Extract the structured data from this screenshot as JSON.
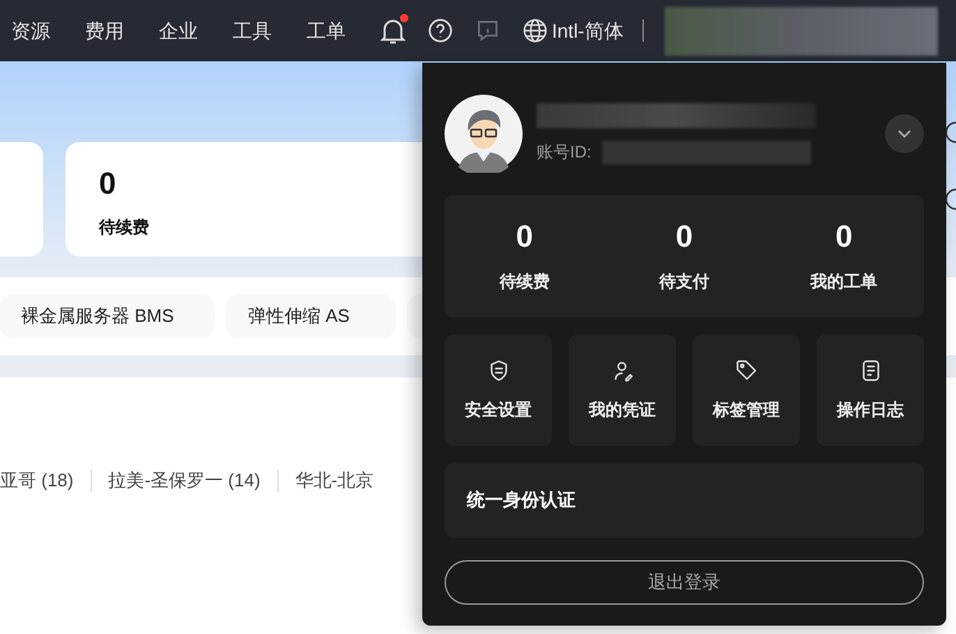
{
  "nav": {
    "items": [
      "资源",
      "费用",
      "企业",
      "工具",
      "工单"
    ],
    "notifications_unread": true,
    "language": "Intl-简体"
  },
  "summary_card": {
    "value": "0",
    "label": "待续费"
  },
  "services": [
    "裸金属服务器 BMS",
    "弹性伸缩 AS"
  ],
  "regions": [
    "亚哥 (18)",
    "拉美-圣保罗一 (14)",
    "华北-北京"
  ],
  "account_panel": {
    "id_label": "账号ID:",
    "stats": [
      {
        "value": "0",
        "label": "待续费"
      },
      {
        "value": "0",
        "label": "待支付"
      },
      {
        "value": "0",
        "label": "我的工单"
      }
    ],
    "shortcuts": [
      {
        "kind": "shield",
        "label": "安全设置"
      },
      {
        "kind": "credential",
        "label": "我的凭证"
      },
      {
        "kind": "tag",
        "label": "标签管理"
      },
      {
        "kind": "log",
        "label": "操作日志"
      }
    ],
    "identity_link": "统一身份认证",
    "logout": "退出登录"
  }
}
